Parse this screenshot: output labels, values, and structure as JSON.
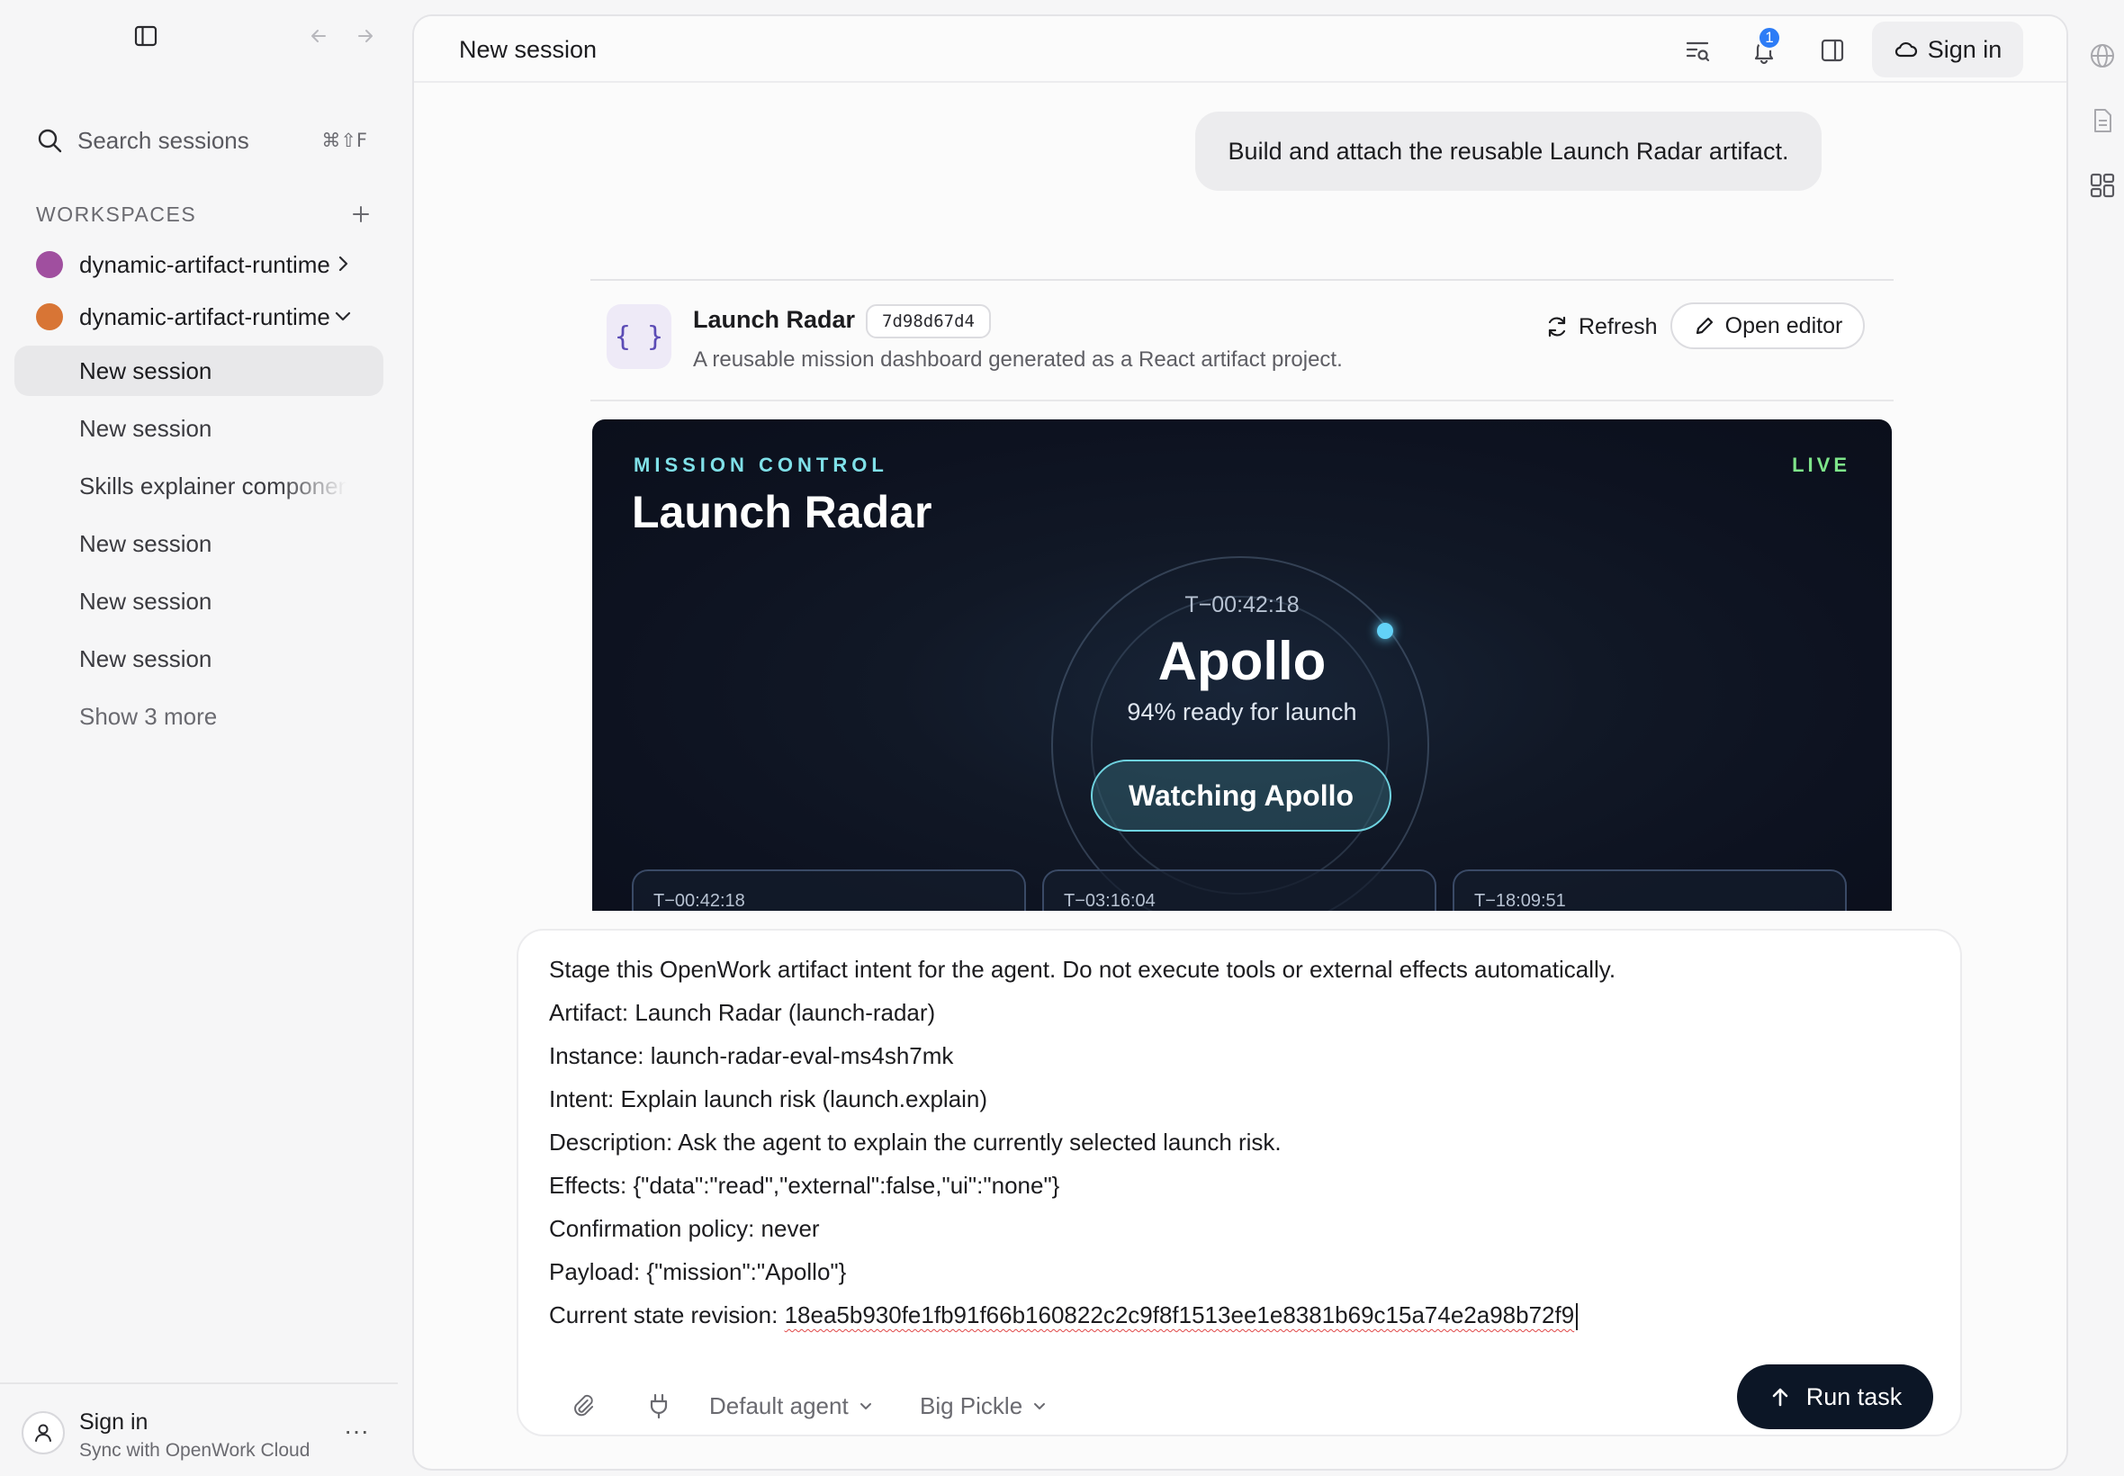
{
  "sidebar": {
    "search": {
      "label": "Search sessions",
      "shortcut": "⌘⇧F"
    },
    "workspaces_label": "WORKSPACES",
    "workspaces": [
      {
        "name": "dynamic-artifact-runtime",
        "color": "#a04f9f",
        "expanded": false
      },
      {
        "name": "dynamic-artifact-runtime",
        "color": "#d87535",
        "expanded": true
      }
    ],
    "sessions": [
      {
        "label": "New session",
        "active": true
      },
      {
        "label": "New session",
        "active": false
      },
      {
        "label": "Skills explainer component",
        "active": false
      },
      {
        "label": "New session",
        "active": false
      },
      {
        "label": "New session",
        "active": false
      },
      {
        "label": "New session",
        "active": false
      }
    ],
    "show_more": "Show 3 more",
    "footer": {
      "title": "Sign in",
      "subtitle": "Sync with OpenWork Cloud",
      "more": "···"
    }
  },
  "topbar": {
    "title": "New session",
    "notification_count": "1",
    "sign_in": "Sign in"
  },
  "message": {
    "text": "Build and attach the reusable Launch Radar artifact."
  },
  "artifact": {
    "icon": "{ }",
    "title": "Launch Radar",
    "hash": "7d98d67d4",
    "description": "A reusable mission dashboard generated as a React artifact project.",
    "refresh_label": "Refresh",
    "editor_label": "Open editor",
    "preview": {
      "eyebrow": "MISSION CONTROL",
      "status": "LIVE",
      "title": "Launch Radar",
      "countdown": "T−00:42:18",
      "mission": "Apollo",
      "ready_percent": 94,
      "readiness": "94% ready for launch",
      "watch_button": "Watching Apollo",
      "tiles": [
        "T−00:42:18",
        "T−03:16:04",
        "T−18:09:51"
      ],
      "accent_cyan": "#7fe0e8",
      "accent_green": "#7ee58a"
    }
  },
  "composer": {
    "lines": [
      "Stage this OpenWork artifact intent for the agent. Do not execute tools or external effects automatically.",
      "Artifact: Launch Radar (launch-radar)",
      "Instance: launch-radar-eval-ms4sh7mk",
      "Intent: Explain launch risk (launch.explain)",
      "Description: Ask the agent to explain the currently selected launch risk.",
      "Effects: {\"data\":\"read\",\"external\":false,\"ui\":\"none\"}",
      "Confirmation policy: never",
      "Payload: {\"mission\":\"Apollo\"}"
    ],
    "revision_label": "Current state revision: ",
    "revision_value": "18ea5b930fe1fb91f66b160822c2c9f8f1513ee1e8381b69c15a74e2a98b72f9",
    "agent": "Default agent",
    "model": "Big Pickle",
    "run_label": "Run task"
  },
  "icons": {
    "sidebar_toggle": "sidebar-toggle-icon",
    "back": "arrow-left-icon",
    "forward": "arrow-right-icon",
    "search": "search-icon",
    "add": "plus-icon",
    "bell": "bell-icon",
    "panel": "panel-icon",
    "cloud": "cloud-icon",
    "attach": "paperclip-icon",
    "plug": "plug-icon"
  }
}
